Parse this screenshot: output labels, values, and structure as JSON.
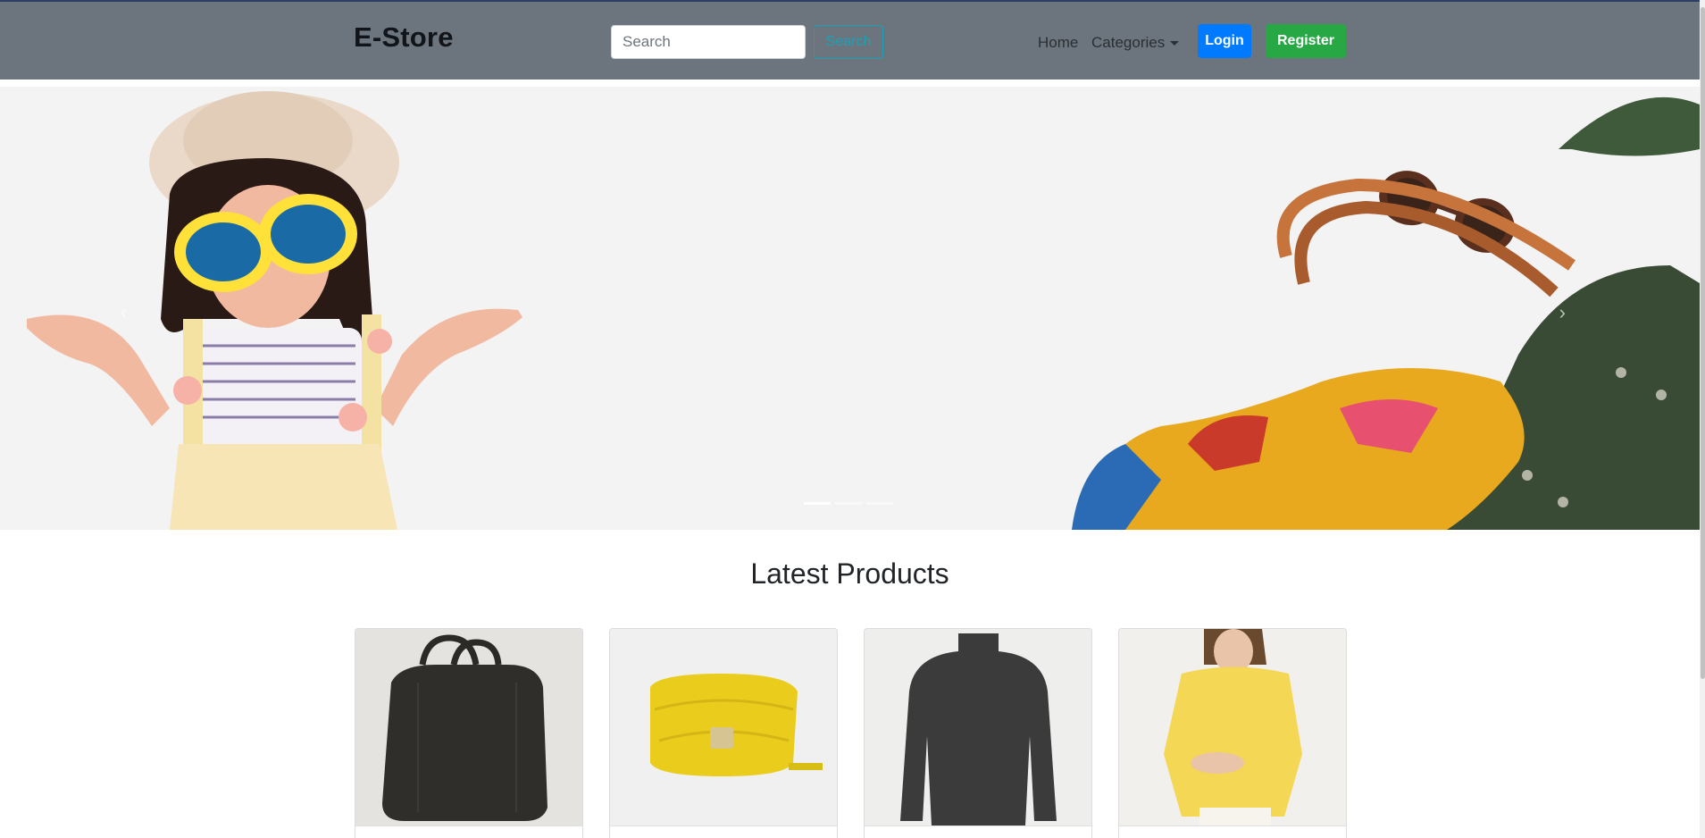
{
  "navbar": {
    "brand": "E-Store",
    "search_placeholder": "Search",
    "search_button": "Search",
    "links": {
      "home": "Home",
      "categories": "Categories"
    },
    "login_button": "Login",
    "register_button": "Register"
  },
  "carousel": {
    "slide_count": 3,
    "active_index": 0,
    "prev_icon": "chevron-left-icon",
    "next_icon": "chevron-right-icon"
  },
  "section": {
    "title": "Latest Products"
  },
  "products": [
    {
      "image": "black-handbag",
      "title": ""
    },
    {
      "image": "yellow-shoulder-bag",
      "title": ""
    },
    {
      "image": "dark-knit-sweater",
      "title": ""
    },
    {
      "image": "yellow-blouse",
      "title": ""
    }
  ],
  "colors": {
    "navbar_bg": "#6c757d",
    "search_accent": "#17a2b8",
    "login_bg": "#007bff",
    "register_bg": "#28a745"
  }
}
